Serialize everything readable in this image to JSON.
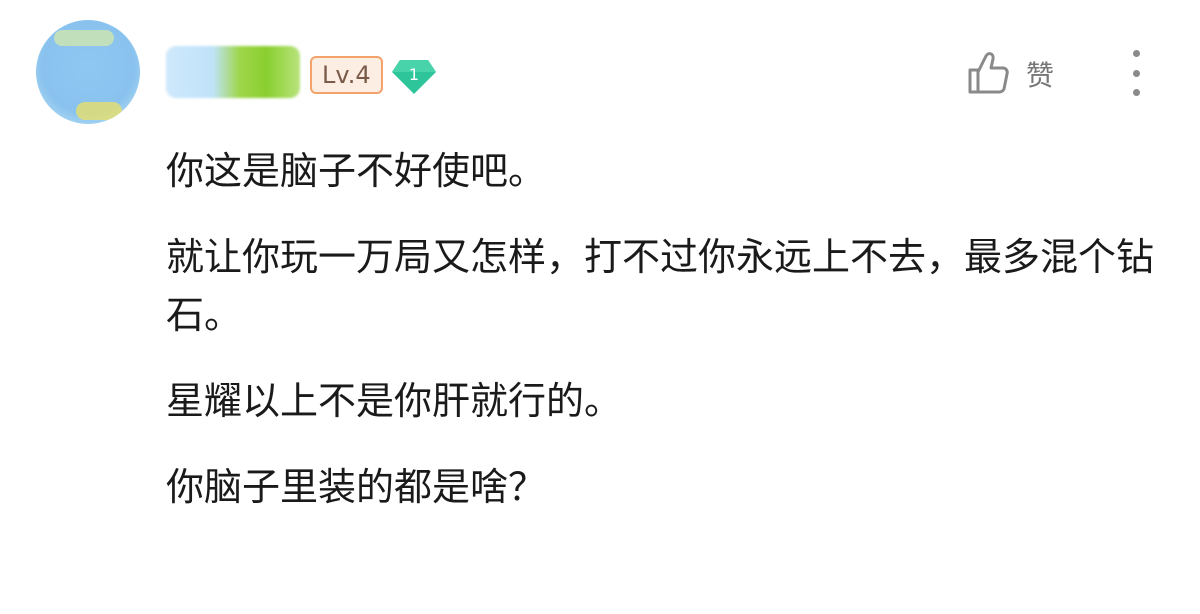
{
  "user": {
    "avatar_icon": "user-avatar",
    "level": "Lv.4",
    "badge_number": "1",
    "badge_color": "#2fc59a"
  },
  "actions": {
    "like_label": "赞",
    "like_icon": "thumbs-up-icon",
    "more_icon": "more-vertical-icon"
  },
  "comment": {
    "paragraphs": [
      "你这是脑子不好使吧。",
      "就让你玩一万局又怎样，打不过你永远上不去，最多混个钻石。",
      "星耀以上不是你肝就行的。",
      "你脑子里装的都是啥？"
    ]
  }
}
